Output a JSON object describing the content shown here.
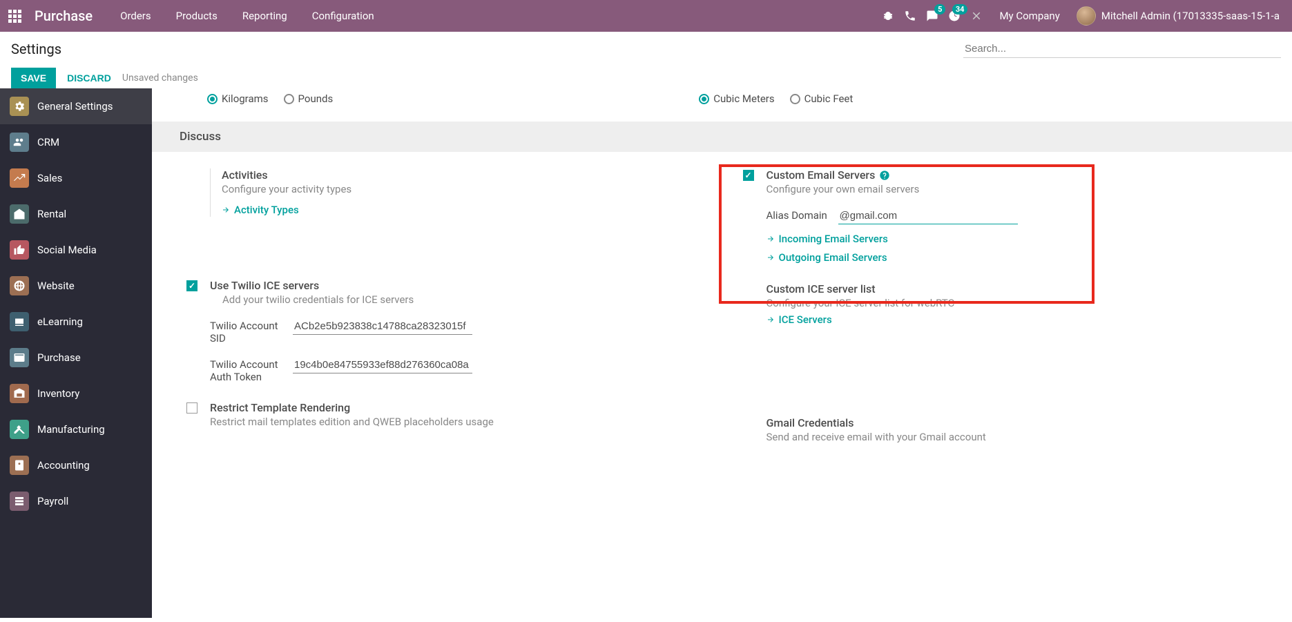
{
  "header": {
    "brand": "Purchase",
    "nav": [
      "Orders",
      "Products",
      "Reporting",
      "Configuration"
    ],
    "discuss_badge": "5",
    "activity_badge": "34",
    "company": "My Company",
    "user": "Mitchell Admin (17013335-saas-15-1-a"
  },
  "control": {
    "breadcrumb": "Settings",
    "search_placeholder": "Search...",
    "save": "SAVE",
    "discard": "DISCARD",
    "status": "Unsaved changes"
  },
  "sidebar": {
    "items": [
      {
        "label": "General Settings",
        "active": true,
        "color": "#A99154"
      },
      {
        "label": "CRM",
        "color": "#5E7D8C"
      },
      {
        "label": "Sales",
        "color": "#C47B4E"
      },
      {
        "label": "Rental",
        "color": "#4C6B6B"
      },
      {
        "label": "Social Media",
        "color": "#B75760"
      },
      {
        "label": "Website",
        "color": "#9C6F53"
      },
      {
        "label": "eLearning",
        "color": "#3E5F6F"
      },
      {
        "label": "Purchase",
        "color": "#5C7C8A"
      },
      {
        "label": "Inventory",
        "color": "#A06A4E"
      },
      {
        "label": "Manufacturing",
        "color": "#3EA089"
      },
      {
        "label": "Accounting",
        "color": "#9C6F53"
      },
      {
        "label": "Payroll",
        "color": "#7B5D6F"
      }
    ]
  },
  "units": {
    "weight": {
      "opt1": "Kilograms",
      "opt2": "Pounds"
    },
    "volume": {
      "opt1": "Cubic Meters",
      "opt2": "Cubic Feet"
    }
  },
  "section": "Discuss",
  "left_col": {
    "activities": {
      "title": "Activities",
      "desc": "Configure your activity types",
      "link": "Activity Types"
    },
    "twilio": {
      "title": "Use Twilio ICE servers",
      "desc": "Add your twilio credentials for ICE servers",
      "sid_label": "Twilio Account SID",
      "sid_value": "ACb2e5b923838c14788ca28323015f",
      "token_label": "Twilio Account Auth Token",
      "token_value": "19c4b0e84755933ef88d276360ca08a"
    },
    "restrict": {
      "title": "Restrict Template Rendering",
      "desc": "Restrict mail templates edition and QWEB placeholders usage"
    }
  },
  "right_col": {
    "email": {
      "title": "Custom Email Servers",
      "desc": "Configure your own email servers",
      "alias_label": "Alias Domain",
      "alias_value": "@gmail.com",
      "link1": "Incoming Email Servers",
      "link2": "Outgoing Email Servers"
    },
    "ice": {
      "title": "Custom ICE server list",
      "desc": "Configure your ICE server list for webRTC",
      "link": "ICE Servers"
    },
    "gmail": {
      "title": "Gmail Credentials",
      "desc": "Send and receive email with your Gmail account"
    }
  }
}
